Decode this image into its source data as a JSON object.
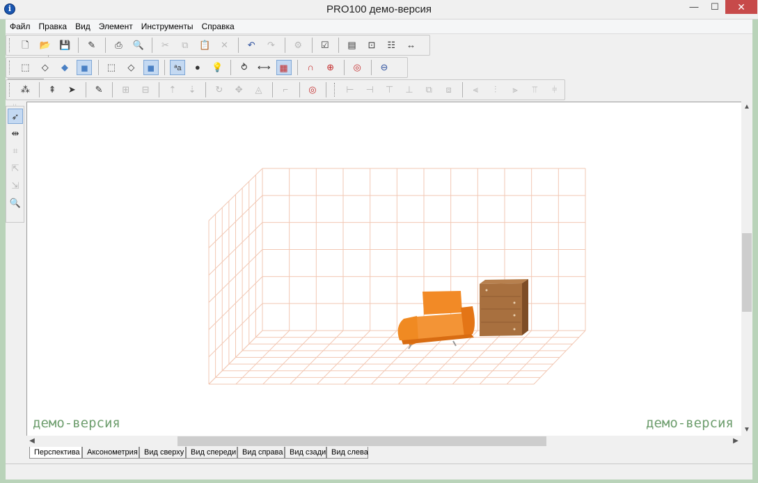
{
  "window": {
    "title": "PRO100 демо-версия",
    "icon_letter": "i",
    "minimize_glyph": "—",
    "maximize_glyph": "☐",
    "close_glyph": "✕"
  },
  "menu": [
    "Файл",
    "Правка",
    "Вид",
    "Элемент",
    "Инструменты",
    "Справка"
  ],
  "toolbar1": [
    "new-file",
    "open-folder",
    "save",
    "sep",
    "edit-properties",
    "sep",
    "print",
    "print-preview",
    "sep",
    "cut",
    "copy",
    "paste",
    "delete",
    "sep",
    "undo",
    "redo",
    "sep",
    "settings",
    "sep",
    "checklist",
    "sep",
    "report",
    "report-preview",
    "report-list",
    "dimensions",
    "export",
    "calculator",
    "sep",
    "sum"
  ],
  "toolbar2_zoom_value": "",
  "viewport": {
    "watermark_left": "демо-версия",
    "watermark_right": "демо-версия",
    "grid_color": "#f2c7b3",
    "armchair_color": "#f28a26",
    "dresser_color": "#a8703f"
  },
  "tabs": [
    "Перспектива",
    "Аксонометрия",
    "Вид сверху",
    "Вид спереди",
    "Вид справа",
    "Вид сзади",
    "Вид слева"
  ],
  "selected_tab": "Перспектива"
}
